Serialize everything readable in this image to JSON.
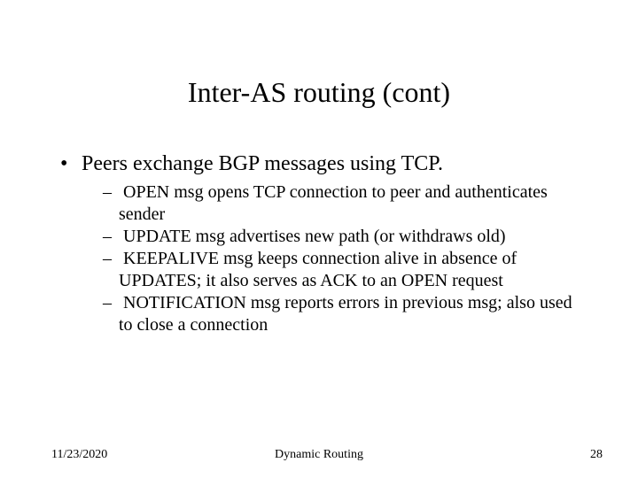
{
  "title": "Inter-AS routing (cont)",
  "bullet": "Peers exchange BGP messages using TCP.",
  "sub": [
    "OPEN msg opens TCP connection to peer and authenticates sender",
    "UPDATE msg advertises new path (or withdraws old)",
    "KEEPALIVE msg keeps connection alive in absence of UPDATES; it also serves as ACK to an OPEN request",
    "NOTIFICATION msg reports errors in previous msg; also used to close a connection"
  ],
  "footer": {
    "date": "11/23/2020",
    "title": "Dynamic Routing",
    "number": "28"
  }
}
